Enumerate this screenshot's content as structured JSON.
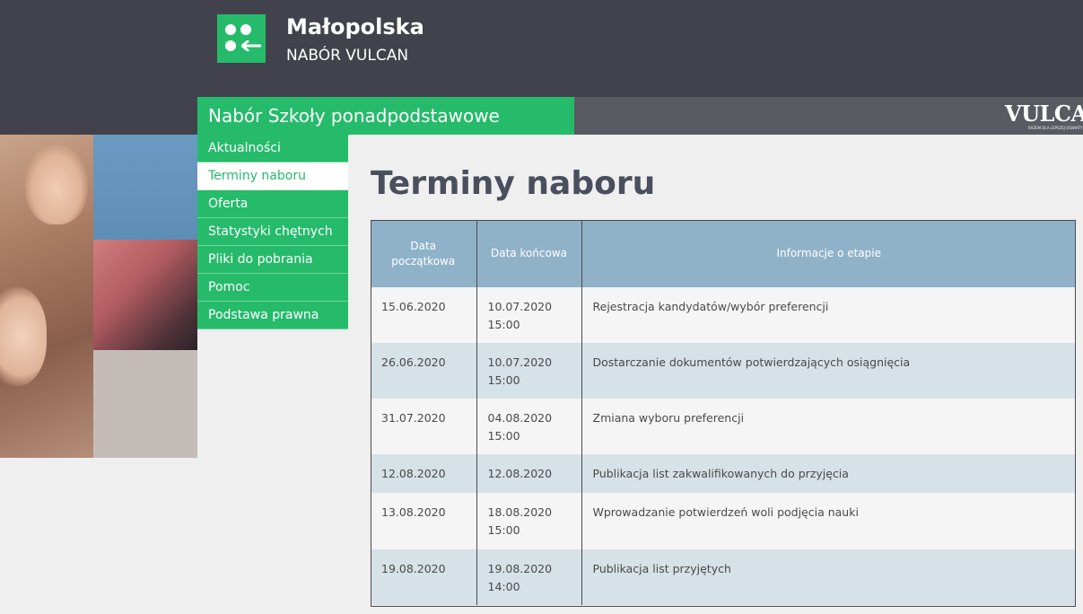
{
  "header": {
    "title": "Małopolska",
    "subtitle": "NABÓR VULCAN"
  },
  "section": {
    "title": "Nabór Szkoły ponadpodstawowe"
  },
  "vendor": {
    "logo_text": "VULCAN",
    "tagline": "RAZEM DLA LEPSZEJ OŚWIATY"
  },
  "nav": {
    "items": [
      {
        "label": "Aktualności",
        "active": false
      },
      {
        "label": "Terminy naboru",
        "active": true
      },
      {
        "label": "Oferta",
        "active": false
      },
      {
        "label": "Statystyki chętnych",
        "active": false
      },
      {
        "label": "Pliki do pobrania",
        "active": false
      },
      {
        "label": "Pomoc",
        "active": false
      },
      {
        "label": "Podstawa prawna",
        "active": false
      }
    ]
  },
  "page": {
    "title": "Terminy naboru"
  },
  "table": {
    "headers": [
      "Data początkowa",
      "Data końcowa",
      "Informacje o etapie"
    ],
    "rows": [
      {
        "start": "15.06.2020",
        "end_date": "10.07.2020",
        "end_time": "15:00",
        "info": "Rejestracja kandydatów/wybór preferencji"
      },
      {
        "start": "26.06.2020",
        "end_date": "10.07.2020",
        "end_time": "15:00",
        "info": "Dostarczanie dokumentów potwierdzających osiągnięcia"
      },
      {
        "start": "31.07.2020",
        "end_date": "04.08.2020",
        "end_time": "15:00",
        "info": "Zmiana wyboru preferencji"
      },
      {
        "start": "12.08.2020",
        "end_date": "12.08.2020",
        "end_time": "",
        "info": "Publikacja list zakwalifikowanych do przyjęcia"
      },
      {
        "start": "13.08.2020",
        "end_date": "18.08.2020",
        "end_time": "15:00",
        "info": "Wprowadzanie potwierdzeń woli podjęcia nauki"
      },
      {
        "start": "19.08.2020",
        "end_date": "19.08.2020",
        "end_time": "14:00",
        "info": "Publikacja list przyjętych"
      }
    ]
  },
  "colors": {
    "header_bg": "#42424c",
    "brand_green": "#25bb6b",
    "vendor_bar": "#5a5a63",
    "table_header": "#8fb2c9",
    "row_alt": "#d6e1e8",
    "title_text": "#4a4f5e"
  }
}
